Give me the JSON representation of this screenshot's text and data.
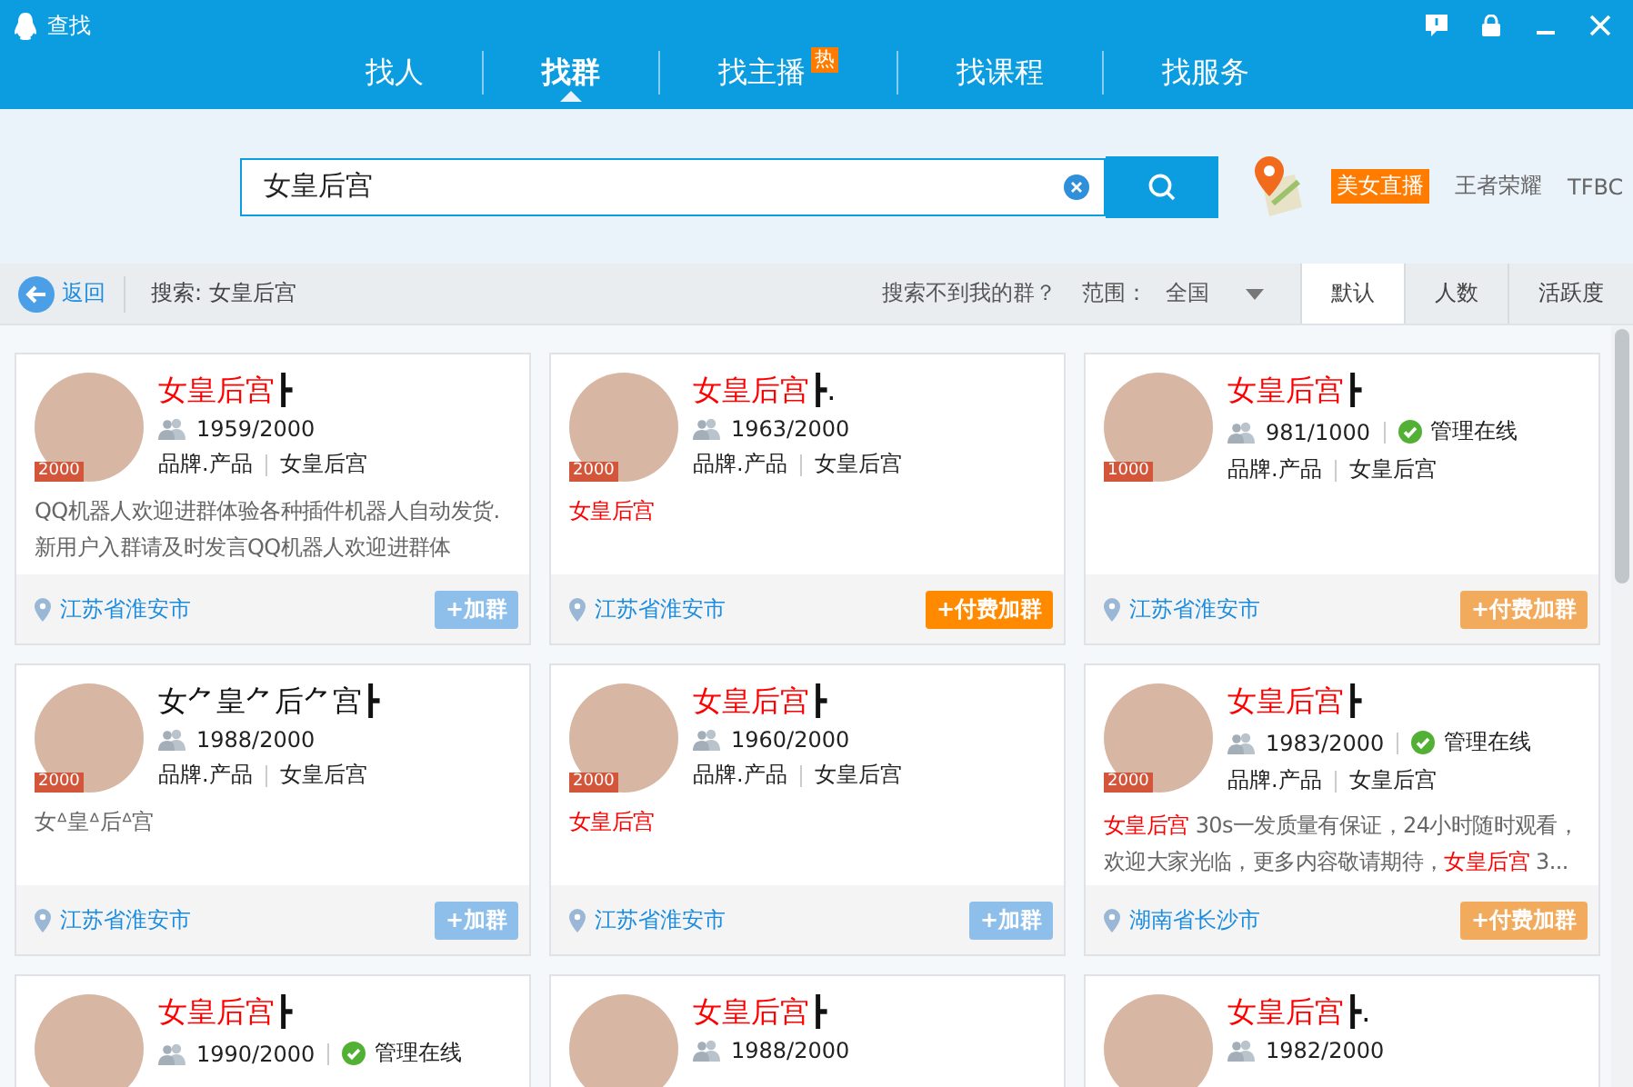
{
  "window": {
    "title": "查找"
  },
  "nav_tabs": [
    {
      "label": "找人",
      "selected": false
    },
    {
      "label": "找群",
      "selected": true
    },
    {
      "label": "找主播",
      "selected": false,
      "badge": "热"
    },
    {
      "label": "找课程",
      "selected": false
    },
    {
      "label": "找服务",
      "selected": false
    }
  ],
  "search": {
    "value": "女皇后宫"
  },
  "hot_tags": [
    {
      "label": "美女直播",
      "kind": "hot"
    },
    {
      "label": "王者荣耀",
      "kind": "plain"
    },
    {
      "label": "TFBC",
      "kind": "plain"
    }
  ],
  "filter_bar": {
    "back": "返回",
    "query": "搜索: 女皇后宫",
    "help_link": "搜索不到我的群？",
    "range_label": "范围：",
    "range_value": "全国",
    "sort_tabs": [
      {
        "label": "默认",
        "selected": true
      },
      {
        "label": "人数",
        "selected": false
      },
      {
        "label": "活跃度",
        "selected": false
      }
    ]
  },
  "cards": [
    {
      "title": [
        {
          "text": "女皇后宫",
          "highlight": true
        },
        {
          "text": "┣",
          "highlight": false
        }
      ],
      "level": "2000",
      "members": "1959/2000",
      "tags": [
        "品牌.产品",
        "女皇后宫"
      ],
      "description": [
        {
          "text": "QQ机器人欢迎进群体验各种插件机器人自动发货.新用户入群请及时发言QQ机器人欢迎进群体",
          "highlight": false
        }
      ],
      "location": "江苏省淮安市",
      "button": {
        "label": "+加群",
        "kind": "join",
        "highlighted": false
      }
    },
    {
      "title": [
        {
          "text": "女皇后宫",
          "highlight": true
        },
        {
          "text": "┣.",
          "highlight": false
        }
      ],
      "level": "2000",
      "members": "1963/2000",
      "tags": [
        "品牌.产品",
        "女皇后宫"
      ],
      "description": [
        {
          "text": "女皇后宫",
          "highlight": true
        }
      ],
      "location": "江苏省淮安市",
      "button": {
        "label": "+付费加群",
        "kind": "paid",
        "highlighted": true
      }
    },
    {
      "title": [
        {
          "text": "女皇后宫",
          "highlight": true
        },
        {
          "text": "┣",
          "highlight": false
        }
      ],
      "level": "1000",
      "members": "981/1000",
      "admin": "管理在线",
      "tags": [
        "品牌.产品",
        "女皇后宫"
      ],
      "location": "江苏省淮安市",
      "button": {
        "label": "+付费加群",
        "kind": "paid",
        "highlighted": false
      }
    },
    {
      "title": [
        {
          "text": "女⺈皇⺈后⺈宫┣",
          "highlight": false
        }
      ],
      "level": "2000",
      "members": "1988/2000",
      "tags": [
        "品牌.产品",
        "女皇后宫"
      ],
      "description": [
        {
          "text": "女ᐞ皇ᐞ后ᐞ宫",
          "highlight": false
        }
      ],
      "location": "江苏省淮安市",
      "button": {
        "label": "+加群",
        "kind": "join",
        "highlighted": false
      }
    },
    {
      "title": [
        {
          "text": "女皇后宫",
          "highlight": true
        },
        {
          "text": "┣",
          "highlight": false
        }
      ],
      "level": "2000",
      "members": "1960/2000",
      "tags": [
        "品牌.产品",
        "女皇后宫"
      ],
      "description": [
        {
          "text": "女皇后宫",
          "highlight": true
        }
      ],
      "location": "江苏省淮安市",
      "button": {
        "label": "+加群",
        "kind": "join",
        "highlighted": false
      }
    },
    {
      "title": [
        {
          "text": "女皇后宫",
          "highlight": true
        },
        {
          "text": "┣",
          "highlight": false
        }
      ],
      "level": "2000",
      "members": "1983/2000",
      "admin": "管理在线",
      "tags": [
        "品牌.产品",
        "女皇后宫"
      ],
      "description": [
        {
          "text": "女皇后宫",
          "highlight": true
        },
        {
          "text": " 30s一发质量有保证，24小时随时观看，欢迎大家光临，更多内容敬请期待，",
          "highlight": false
        },
        {
          "text": "女皇后宫",
          "highlight": true
        },
        {
          "text": " 3...",
          "highlight": false
        }
      ],
      "location": "湖南省长沙市",
      "button": {
        "label": "+付费加群",
        "kind": "paid",
        "highlighted": false
      }
    },
    {
      "title": [
        {
          "text": "女皇后宫",
          "highlight": true
        },
        {
          "text": "┣",
          "highlight": false
        }
      ],
      "members": "1990/2000",
      "admin": "管理在线"
    },
    {
      "title": [
        {
          "text": "女皇后宫",
          "highlight": true
        },
        {
          "text": "┣",
          "highlight": false
        }
      ],
      "members": "1988/2000"
    },
    {
      "title": [
        {
          "text": "女皇后宫",
          "highlight": true
        },
        {
          "text": "┣.",
          "highlight": false
        }
      ],
      "members": "1982/2000"
    }
  ]
}
